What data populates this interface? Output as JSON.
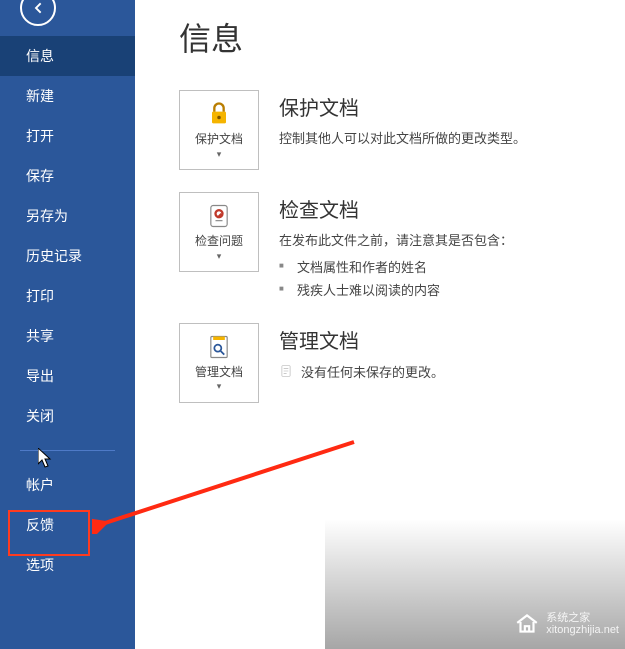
{
  "sidebar": {
    "items": [
      {
        "label": "信息",
        "selected": true
      },
      {
        "label": "新建"
      },
      {
        "label": "打开"
      },
      {
        "label": "保存"
      },
      {
        "label": "另存为"
      },
      {
        "label": "历史记录"
      },
      {
        "label": "打印"
      },
      {
        "label": "共享"
      },
      {
        "label": "导出"
      },
      {
        "label": "关闭"
      }
    ],
    "lower": [
      {
        "label": "帐户"
      },
      {
        "label": "反馈"
      },
      {
        "label": "选项"
      }
    ]
  },
  "page": {
    "title": "信息"
  },
  "protect": {
    "tile": "保护文档",
    "title": "保护文档",
    "desc": "控制其他人可以对此文档所做的更改类型。"
  },
  "inspect": {
    "tile": "检查问题",
    "title": "检查文档",
    "desc": "在发布此文件之前，请注意其是否包含：",
    "bullets": [
      "文档属性和作者的姓名",
      "残疾人士难以阅读的内容"
    ]
  },
  "manage": {
    "tile": "管理文档",
    "title": "管理文档",
    "line": "没有任何未保存的更改。"
  },
  "watermark": {
    "line1": "系统之家",
    "line2": "xitongzhijia.net"
  }
}
